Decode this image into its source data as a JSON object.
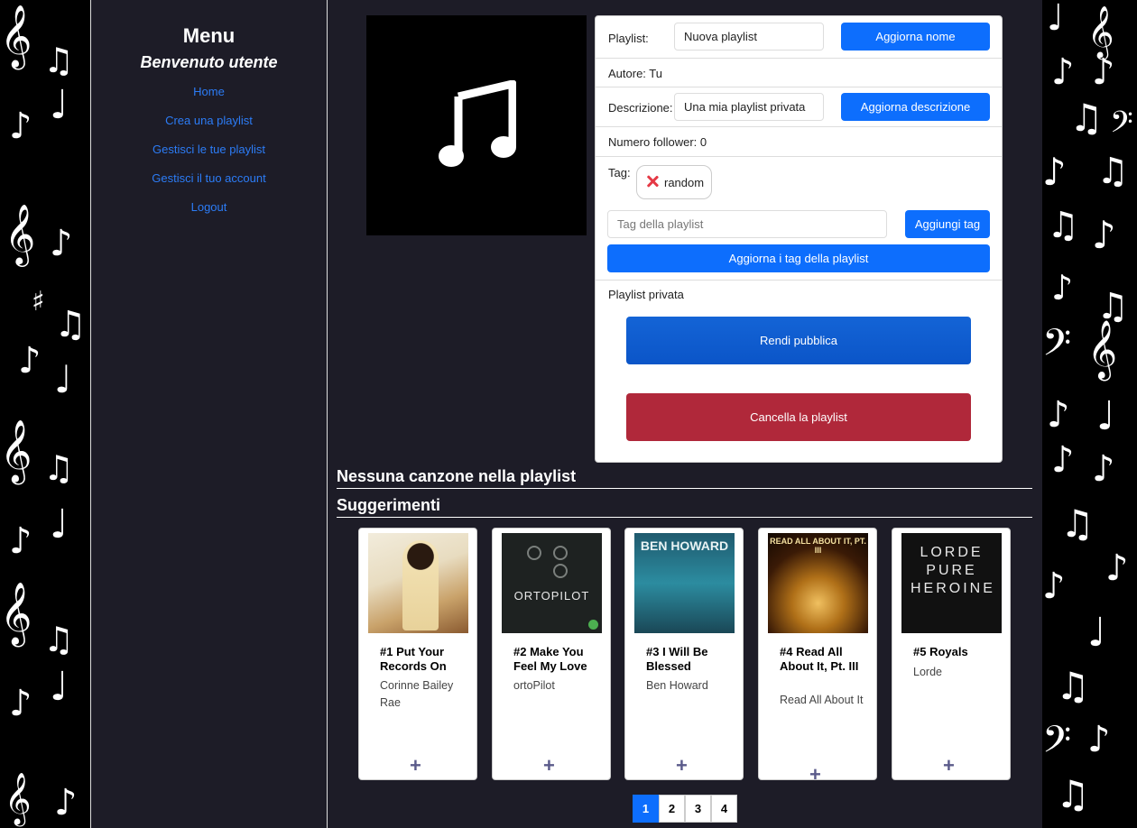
{
  "menu": {
    "title": "Menu",
    "welcome": "Benvenuto utente",
    "links": [
      "Home",
      "Crea una playlist",
      "Gestisci le tue playlist",
      "Gestisci il tuo account",
      "Logout"
    ]
  },
  "playlist": {
    "name_label": "Playlist:",
    "name_value": "Nuova playlist",
    "update_name_button": "Aggiorna nome",
    "author": "Autore: Tu",
    "description_label": "Descrizione:",
    "description_value": "Una mia playlist privata",
    "update_description_button": "Aggiorna descrizione",
    "followers": "Numero follower: 0",
    "tags_label": "Tag:",
    "tags": [
      "random"
    ],
    "tag_input_placeholder": "Tag della playlist",
    "add_tag_button": "Aggiungi tag",
    "update_tags_button": "Aggiorna i tag della playlist",
    "privacy": "Playlist privata",
    "make_public_button": "Rendi pubblica",
    "delete_button": "Cancella la playlist"
  },
  "sections": {
    "empty": "Nessuna canzone nella playlist",
    "suggestions": "Suggerimenti"
  },
  "suggestions": [
    {
      "title": "#1 Put Your Records On",
      "artist": "Corinne Bailey Rae",
      "add": "+",
      "cover_text": ""
    },
    {
      "title": "#2 Make You Feel My Love",
      "artist": "ortoPilot",
      "add": "+",
      "cover_text": "ORTOPILOT"
    },
    {
      "title": "#3 I Will Be Blessed",
      "artist": "Ben Howard",
      "add": "+",
      "cover_text": "BEN HOWARD"
    },
    {
      "title": "#4 Read All About It, Pt. III",
      "artist": "Read All About It",
      "add": "+",
      "cover_text": "READ ALL ABOUT IT, PT. III"
    },
    {
      "title": "#5 Royals",
      "artist": "Lorde",
      "add": "+",
      "cover_text": "LORDE PURE HEROINE"
    }
  ],
  "pagination": {
    "pages": [
      "1",
      "2",
      "3",
      "4"
    ],
    "current": "1"
  },
  "icons": {
    "cover": "music-note-icon",
    "tag_remove": "close-icon"
  },
  "colors": {
    "primary": "#0d6efd",
    "danger": "#b0283a",
    "sidebar_bg": "#1d1c27",
    "link": "#2c7cf6"
  }
}
